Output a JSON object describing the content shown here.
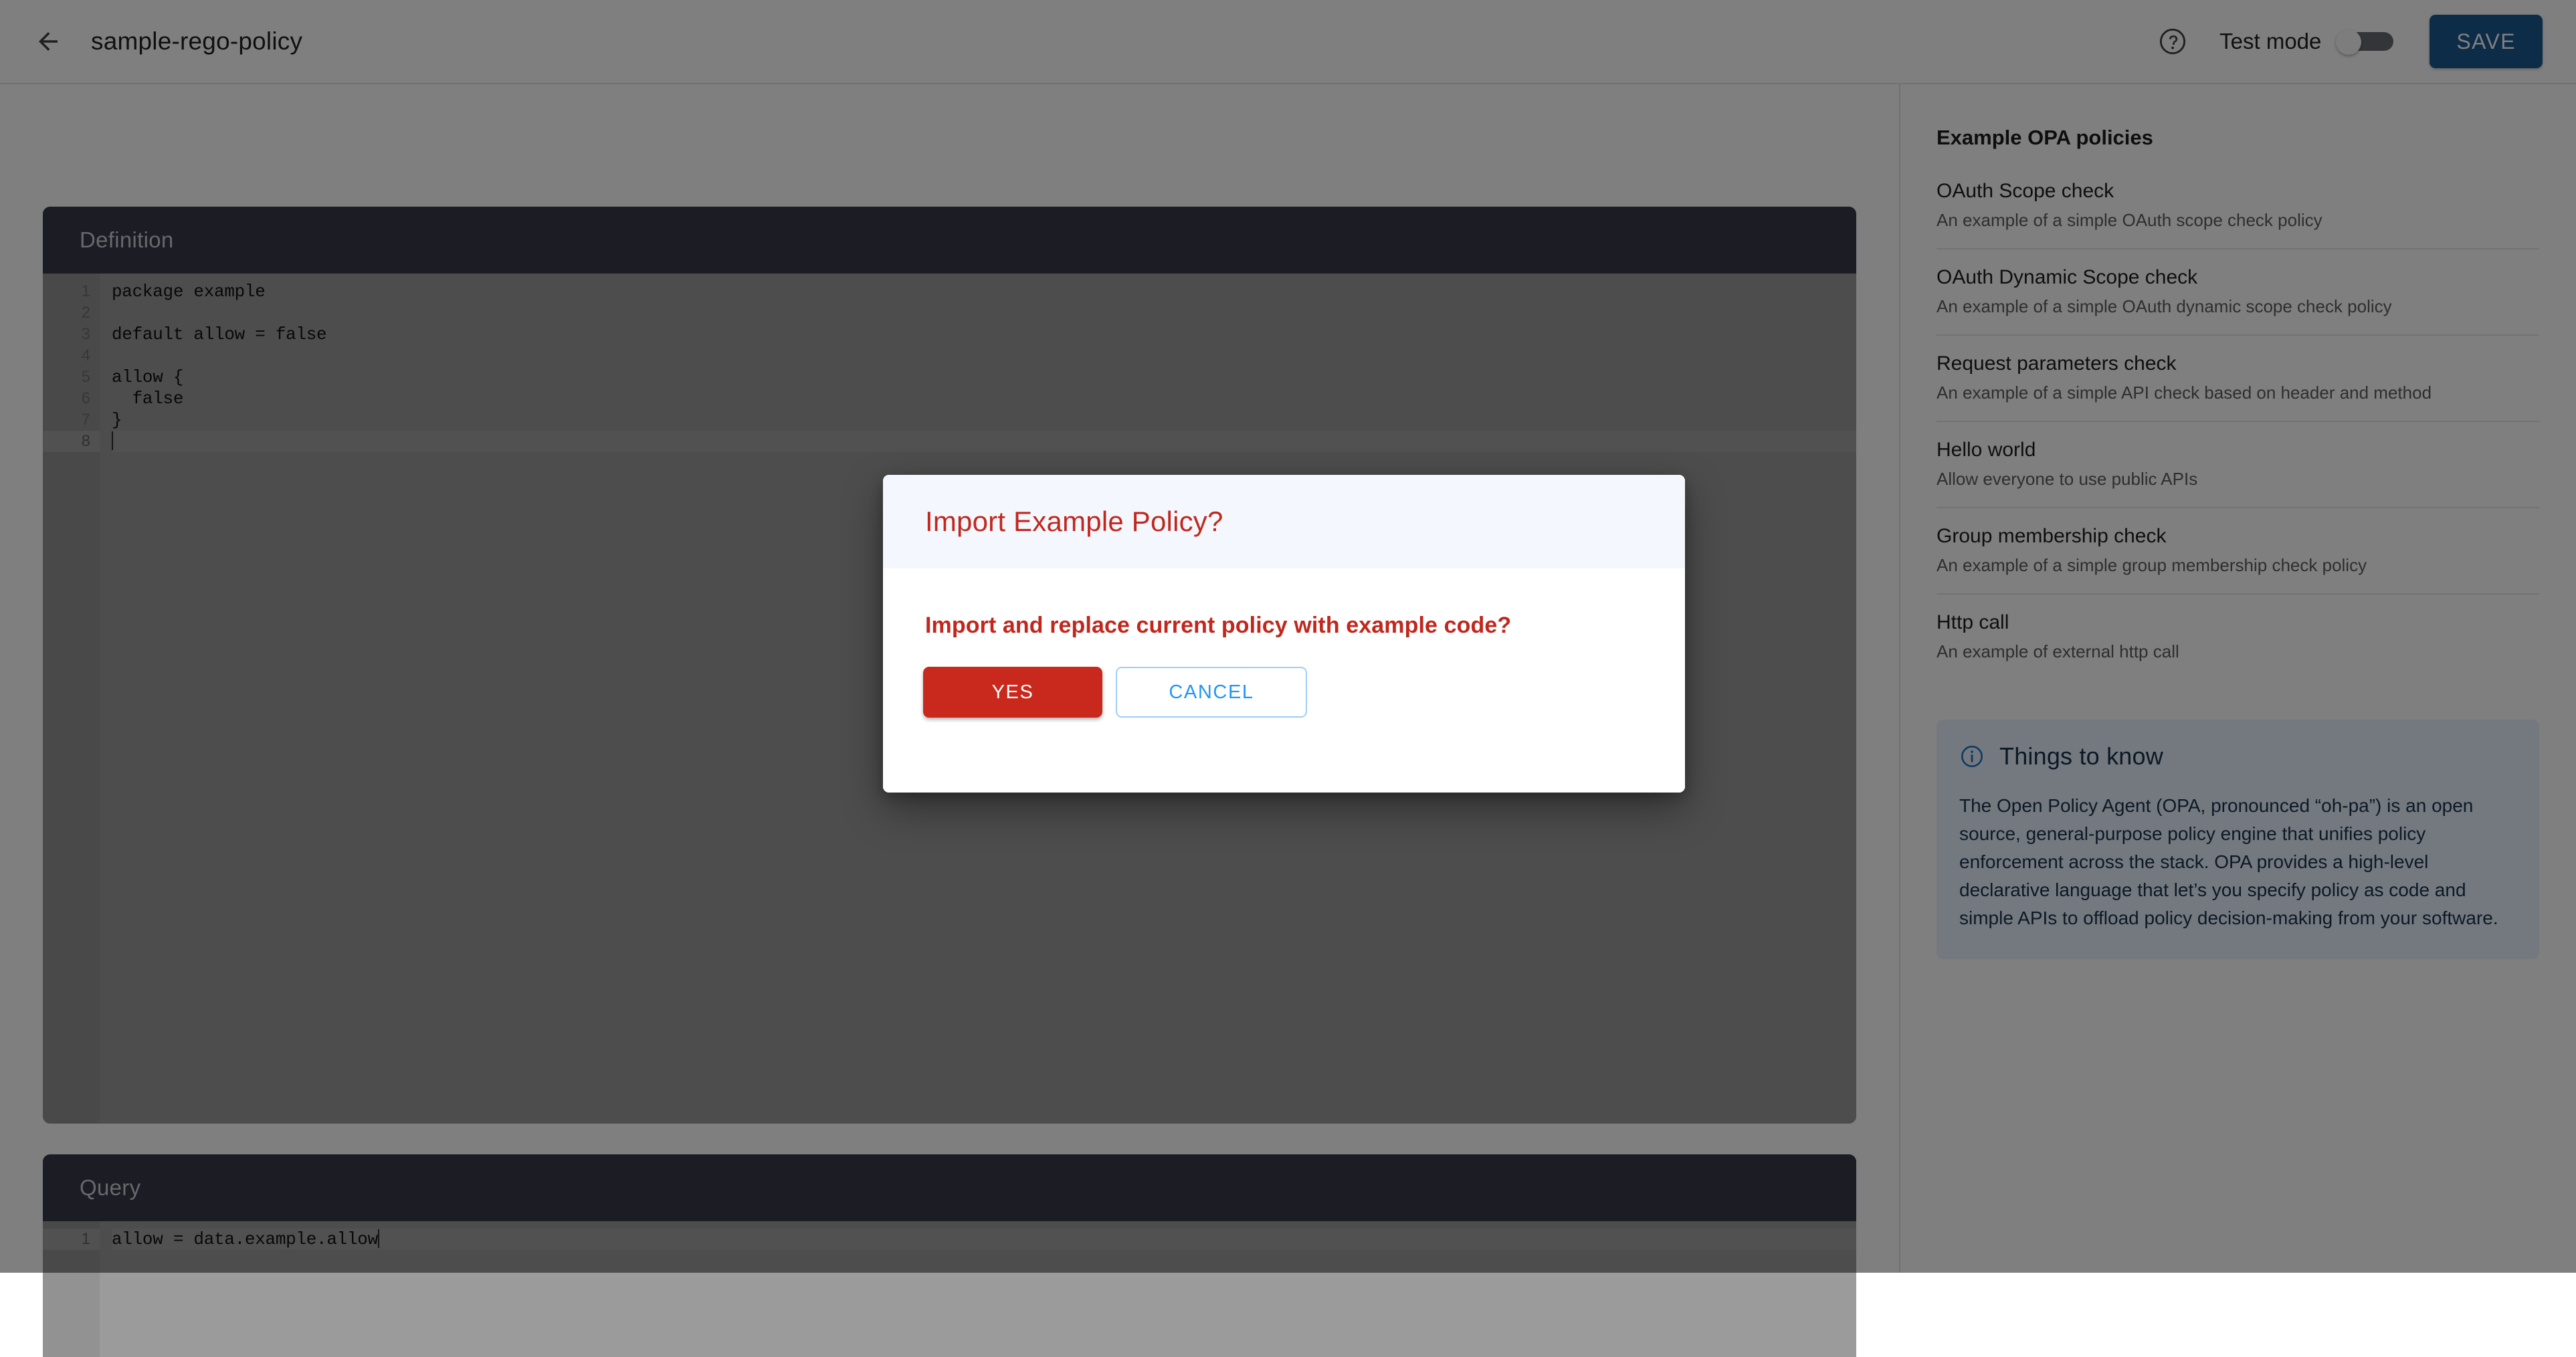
{
  "header": {
    "back_icon": "back-arrow-icon",
    "title": "sample-rego-policy",
    "help_icon": "help-circle-icon",
    "test_mode_label": "Test mode",
    "test_mode_on": false,
    "save_label": "SAVE",
    "save_color": "#19598f"
  },
  "definition_panel": {
    "title": "Definition",
    "lines": [
      "package example",
      "",
      "default allow = false",
      "",
      "allow {",
      "  false",
      "}",
      ""
    ],
    "line_numbers": [
      "1",
      "2",
      "3",
      "4",
      "5",
      "6",
      "7",
      "8"
    ],
    "active_line": 8
  },
  "query_panel": {
    "title": "Query",
    "lines": [
      "allow = data.example.allow"
    ],
    "line_numbers": [
      "1"
    ],
    "active_line": 1
  },
  "sidebar": {
    "title": "Example OPA policies",
    "policies": [
      {
        "name": "OAuth Scope check",
        "description": "An example of a simple OAuth scope check policy"
      },
      {
        "name": "OAuth Dynamic Scope check",
        "description": "An example of a simple OAuth dynamic scope check policy"
      },
      {
        "name": "Request parameters check",
        "description": "An example of a simple API check based on header and method"
      },
      {
        "name": "Hello world",
        "description": "Allow everyone to use public APIs"
      },
      {
        "name": "Group membership check",
        "description": "An example of a simple group membership check policy"
      },
      {
        "name": "Http call",
        "description": "An example of external http call"
      }
    ],
    "things_to_know": {
      "icon": "info-circle-icon",
      "title": "Things to know",
      "body": "The Open Policy Agent (OPA, pronounced “oh-pa”) is an open source, general-purpose policy engine that unifies policy enforcement across the stack. OPA provides a high-level declarative language that let’s you specify policy as code and simple APIs to offload policy decision-making from your software.",
      "accent_color": "#1a73c0",
      "background_color": "#e8f0fe"
    }
  },
  "modal": {
    "title": "Import Example Policy?",
    "message": "Import and replace current policy with example code?",
    "confirm_label": "YES",
    "cancel_label": "CANCEL",
    "confirm_color": "#c9281d",
    "cancel_color": "#2196f3",
    "title_color": "#c1271d"
  }
}
